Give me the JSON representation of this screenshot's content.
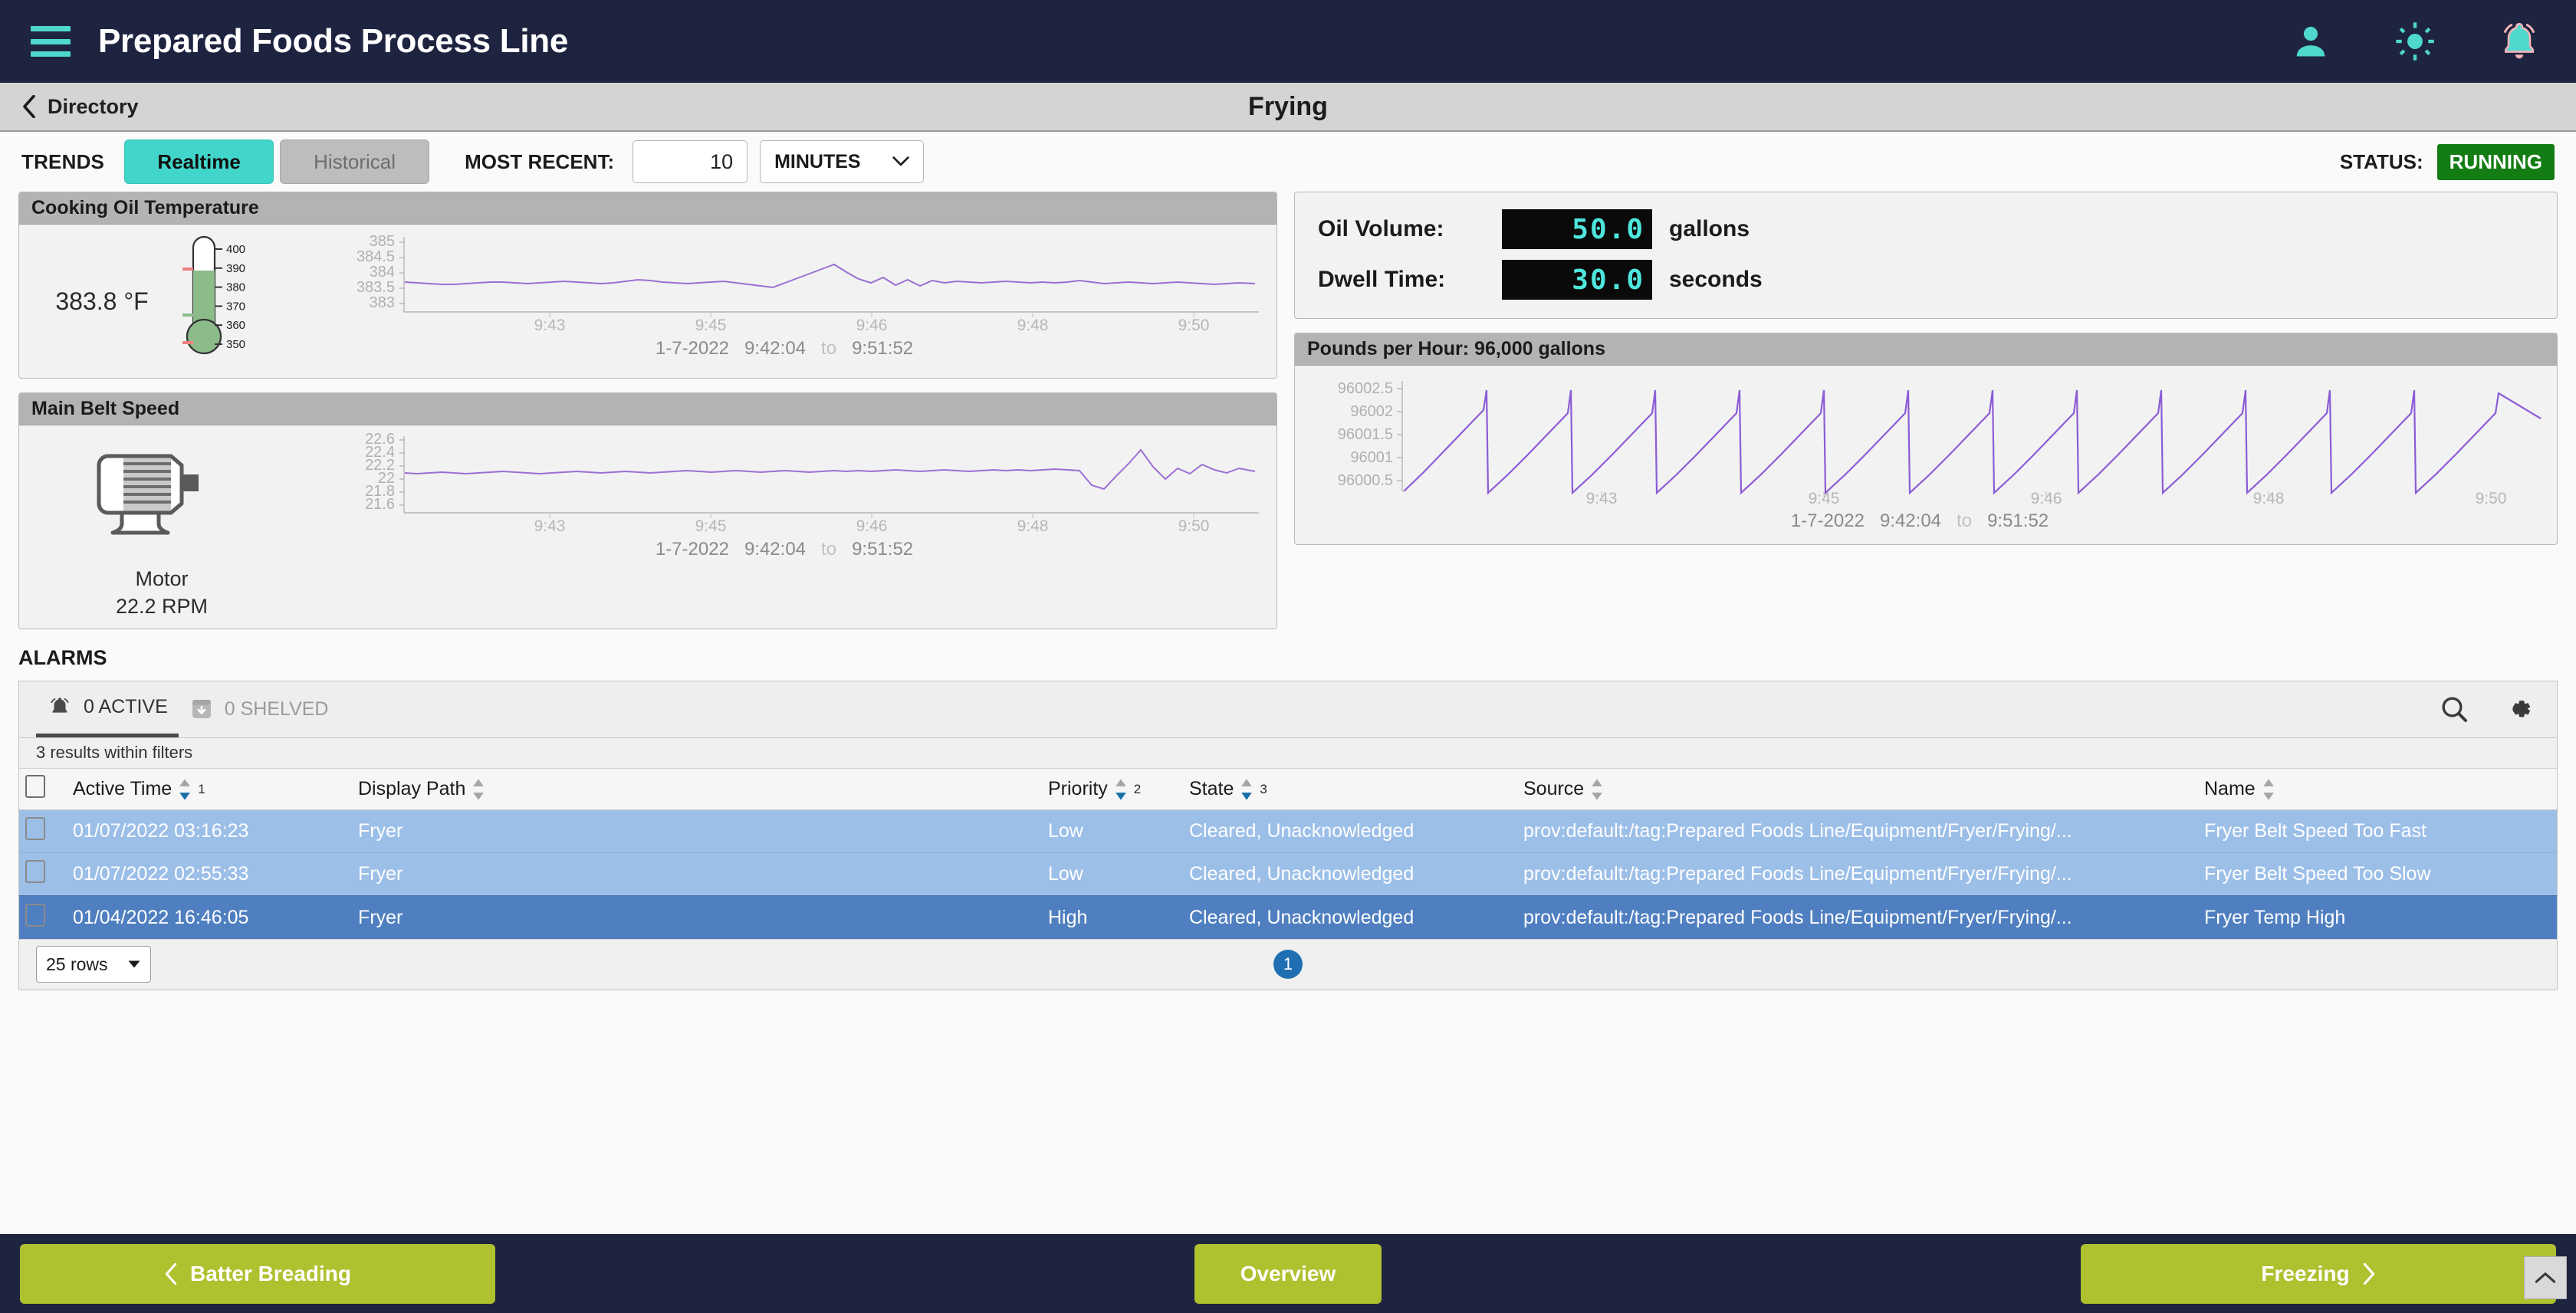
{
  "header": {
    "title": "Prepared Foods Process Line",
    "menu_icon": "hamburger-icon",
    "icons": [
      "user-icon",
      "brightness-icon",
      "alarm-bell-icon"
    ],
    "accent": "#4FD8CD"
  },
  "directory": {
    "back_label": "Directory",
    "page_title": "Frying"
  },
  "trends": {
    "label": "TRENDS",
    "realtime": "Realtime",
    "historical": "Historical",
    "most_recent_label": "MOST RECENT:",
    "amount": "10",
    "unit": "MINUTES",
    "status_label": "STATUS:",
    "status_value": "RUNNING",
    "status_color": "#137D14"
  },
  "oil_temp": {
    "title": "Cooking Oil Temperature",
    "value": "383.8 °F",
    "gauge_ticks": [
      "400",
      "390",
      "380",
      "370",
      "360",
      "350"
    ],
    "range_label": "1-7-2022",
    "range_start": "9:42:04",
    "range_to": "to",
    "range_end": "9:51:52"
  },
  "belt_speed": {
    "title": "Main Belt Speed",
    "device": "Motor",
    "value": "22.2 RPM",
    "range_label": "1-7-2022",
    "range_start": "9:42:04",
    "range_to": "to",
    "range_end": "9:51:52"
  },
  "readouts": [
    {
      "label": "Oil Volume:",
      "value": "50.0",
      "unit": "gallons"
    },
    {
      "label": "Dwell Time:",
      "value": "30.0",
      "unit": "seconds"
    }
  ],
  "pph": {
    "title": "Pounds per Hour:  96,000 gallons",
    "range_label": "1-7-2022",
    "range_start": "9:42:04",
    "range_to": "to",
    "range_end": "9:51:52"
  },
  "alarms": {
    "section_title": "ALARMS",
    "tab_active": "0 ACTIVE",
    "tab_shelved": "0 SHELVED",
    "results_text": "3 results within filters",
    "search_icon": "search-icon",
    "settings_icon": "gear-icon",
    "columns": [
      {
        "label": "Active Time",
        "sort": "desc",
        "order": "1"
      },
      {
        "label": "Display Path",
        "sort": "none",
        "order": ""
      },
      {
        "label": "Priority",
        "sort": "desc",
        "order": "2"
      },
      {
        "label": "State",
        "sort": "desc",
        "order": "3"
      },
      {
        "label": "Source",
        "sort": "none",
        "order": ""
      },
      {
        "label": "Name",
        "sort": "none",
        "order": ""
      }
    ],
    "rows": [
      {
        "active_time": "01/07/2022 03:16:23",
        "display_path": "Fryer",
        "priority": "Low",
        "state": "Cleared, Unacknowledged",
        "source": "prov:default:/tag:Prepared Foods Line/Equipment/Fryer/Frying/...",
        "name": "Fryer Belt Speed Too Fast",
        "style": "row-light"
      },
      {
        "active_time": "01/07/2022 02:55:33",
        "display_path": "Fryer",
        "priority": "Low",
        "state": "Cleared, Unacknowledged",
        "source": "prov:default:/tag:Prepared Foods Line/Equipment/Fryer/Frying/...",
        "name": "Fryer Belt Speed Too Slow",
        "style": "row-light2"
      },
      {
        "active_time": "01/04/2022 16:46:05",
        "display_path": "Fryer",
        "priority": "High",
        "state": "Cleared, Unacknowledged",
        "source": "prov:default:/tag:Prepared Foods Line/Equipment/Fryer/Frying/...",
        "name": "Fryer Temp High",
        "style": "row-dark"
      }
    ],
    "rows_per_page": "25 rows",
    "current_page": "1"
  },
  "bottom_nav": {
    "prev": "Batter Breading",
    "middle": "Overview",
    "next": "Freezing",
    "color": "#AFC12F",
    "scroll_top_icon": "chevron-up-icon"
  },
  "chart_data": [
    {
      "type": "line",
      "title": "Cooking Oil Temperature",
      "ylabel": "",
      "xlabel": "",
      "ylim": [
        383,
        385
      ],
      "yticks": [
        "385",
        "384.5",
        "384",
        "383.5",
        "383"
      ],
      "xticks": [
        "9:43",
        "9:45",
        "9:46",
        "9:48",
        "9:50"
      ],
      "series": [
        {
          "name": "Cooking Oil Temperature",
          "color": "#9C6FD4",
          "values": [
            383.8,
            383.78,
            383.76,
            383.75,
            383.74,
            383.76,
            383.78,
            383.8,
            383.79,
            383.77,
            383.76,
            383.78,
            383.8,
            383.82,
            383.8,
            383.78,
            383.76,
            383.78,
            383.82,
            383.86,
            383.84,
            383.8,
            383.78,
            383.76,
            383.78,
            383.8,
            383.82,
            383.78,
            383.74,
            383.7,
            383.66,
            383.78,
            383.92,
            384.06,
            384.2,
            384.34,
            384.12,
            383.92,
            383.78,
            383.94,
            383.74,
            383.88,
            383.72,
            383.86,
            383.78,
            383.82,
            383.8,
            383.78,
            383.8,
            383.82,
            383.8,
            383.78,
            383.8,
            383.78,
            383.8,
            383.84,
            383.8,
            383.76,
            383.78,
            383.8,
            383.78,
            383.76,
            383.78,
            383.8,
            383.78,
            383.76,
            383.74,
            383.76,
            383.78,
            383.76
          ]
        }
      ]
    },
    {
      "type": "line",
      "title": "Main Belt Speed",
      "ylabel": "",
      "xlabel": "",
      "ylim": [
        21.6,
        22.6
      ],
      "yticks": [
        "22.6",
        "22.4",
        "22.2",
        "22",
        "21.8",
        "21.6"
      ],
      "xticks": [
        "9:43",
        "9:45",
        "9:46",
        "9:48",
        "9:50"
      ],
      "series": [
        {
          "name": "Main Belt Speed",
          "color": "#9C6FD4",
          "values": [
            22.1,
            22.09,
            22.1,
            22.11,
            22.1,
            22.09,
            22.1,
            22.11,
            22.12,
            22.11,
            22.1,
            22.09,
            22.1,
            22.11,
            22.12,
            22.11,
            22.1,
            22.11,
            22.12,
            22.11,
            22.1,
            22.11,
            22.12,
            22.13,
            22.12,
            22.11,
            22.12,
            22.13,
            22.12,
            22.11,
            22.12,
            22.13,
            22.12,
            22.11,
            22.12,
            22.13,
            22.12,
            22.13,
            22.12,
            22.13,
            22.14,
            22.13,
            22.12,
            22.13,
            22.14,
            22.13,
            22.12,
            22.13,
            22.14,
            22.13,
            22.14,
            22.13,
            22.14,
            22.15,
            22.14,
            22.13,
            21.92,
            21.86,
            22.06,
            22.24,
            22.46,
            22.2,
            22.02,
            22.18,
            22.1,
            22.24,
            22.16,
            22.12,
            22.18,
            22.14
          ]
        }
      ]
    },
    {
      "type": "line",
      "title": "Pounds per Hour",
      "ylabel": "",
      "xlabel": "",
      "ylim": [
        96000.3,
        96002.7
      ],
      "yticks": [
        "96002.5",
        "96002",
        "96001.5",
        "96001",
        "96000.5"
      ],
      "xticks": [
        "9:43",
        "9:45",
        "9:46",
        "9:48",
        "9:50"
      ],
      "series": [
        {
          "name": "Pounds per Hour",
          "color": "#8B5CD6",
          "values": [
            96000.6,
            96001.05,
            96001.5,
            96001.95,
            96002.42,
            96000.42,
            96000.88,
            96001.33,
            96001.78,
            96002.42,
            96000.42,
            96000.88,
            96001.33,
            96001.78,
            96002.42,
            96000.42,
            96000.88,
            96001.33,
            96001.78,
            96002.42,
            96000.42,
            96000.88,
            96001.33,
            96001.78,
            96002.42,
            96000.42,
            96000.88,
            96001.33,
            96001.78,
            96002.42,
            96000.42,
            96000.88,
            96001.33,
            96001.78,
            96002.42,
            96000.42,
            96000.88,
            96001.33,
            96001.78,
            96002.42,
            96000.42,
            96000.88,
            96001.33,
            96001.78,
            96002.42,
            96000.42,
            96000.88,
            96001.33,
            96001.78,
            96002.42,
            96000.42,
            96000.88,
            96001.33,
            96001.78,
            96002.2
          ]
        }
      ]
    }
  ]
}
